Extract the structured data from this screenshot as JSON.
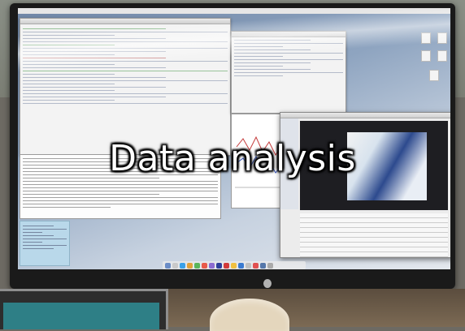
{
  "headline": {
    "text": "Data analysis"
  },
  "colors": {
    "headline_text": "#ffffff",
    "headline_outline": "#000000",
    "desktop_background": "#8ea4c0"
  },
  "scene": {
    "objects": [
      "imac-monitor",
      "rstudio-window",
      "finder-window",
      "dock",
      "laptop",
      "coffee-cup-lid"
    ]
  }
}
